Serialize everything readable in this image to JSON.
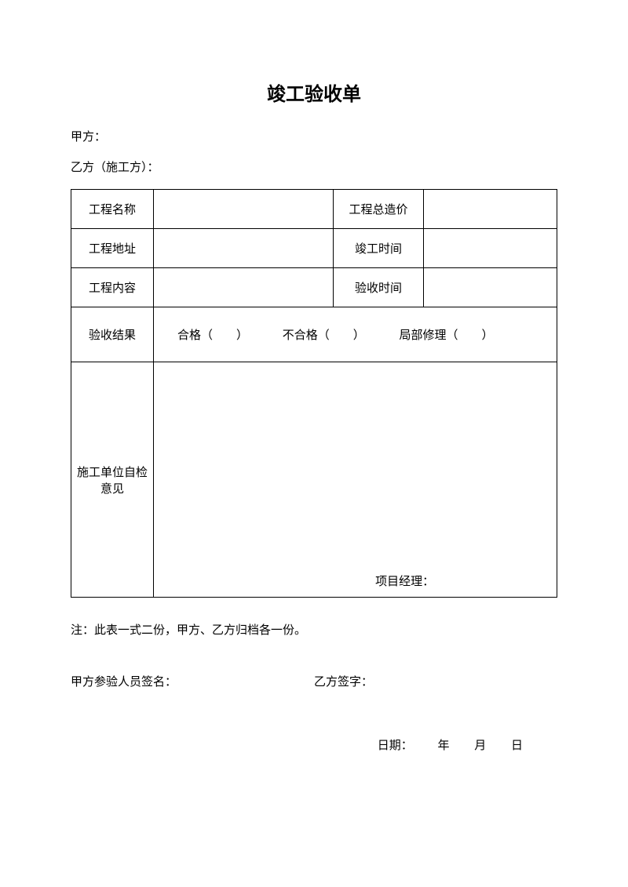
{
  "title": "竣工验收单",
  "partyA": "甲方：",
  "partyB": "乙方（施工方）：",
  "table": {
    "projectName": "工程名称",
    "totalCost": "工程总造价",
    "projectAddress": "工程地址",
    "completionTime": "竣工时间",
    "projectContent": "工程内容",
    "acceptanceTime": "验收时间",
    "acceptanceResult": "验收结果",
    "resultPass": "合格（　　）",
    "resultFail": "不合格（　　）",
    "resultPartial": "局部修理（　　）",
    "selfInspection": "施工单位自检意见",
    "projectManager": "项目经理："
  },
  "note": "注：此表一式二份，甲方、乙方归档各一份。",
  "signA": "甲方参验人员签名：",
  "signB": "乙方签字：",
  "dateLabel": "日期：",
  "year": "年",
  "month": "月",
  "day": "日"
}
